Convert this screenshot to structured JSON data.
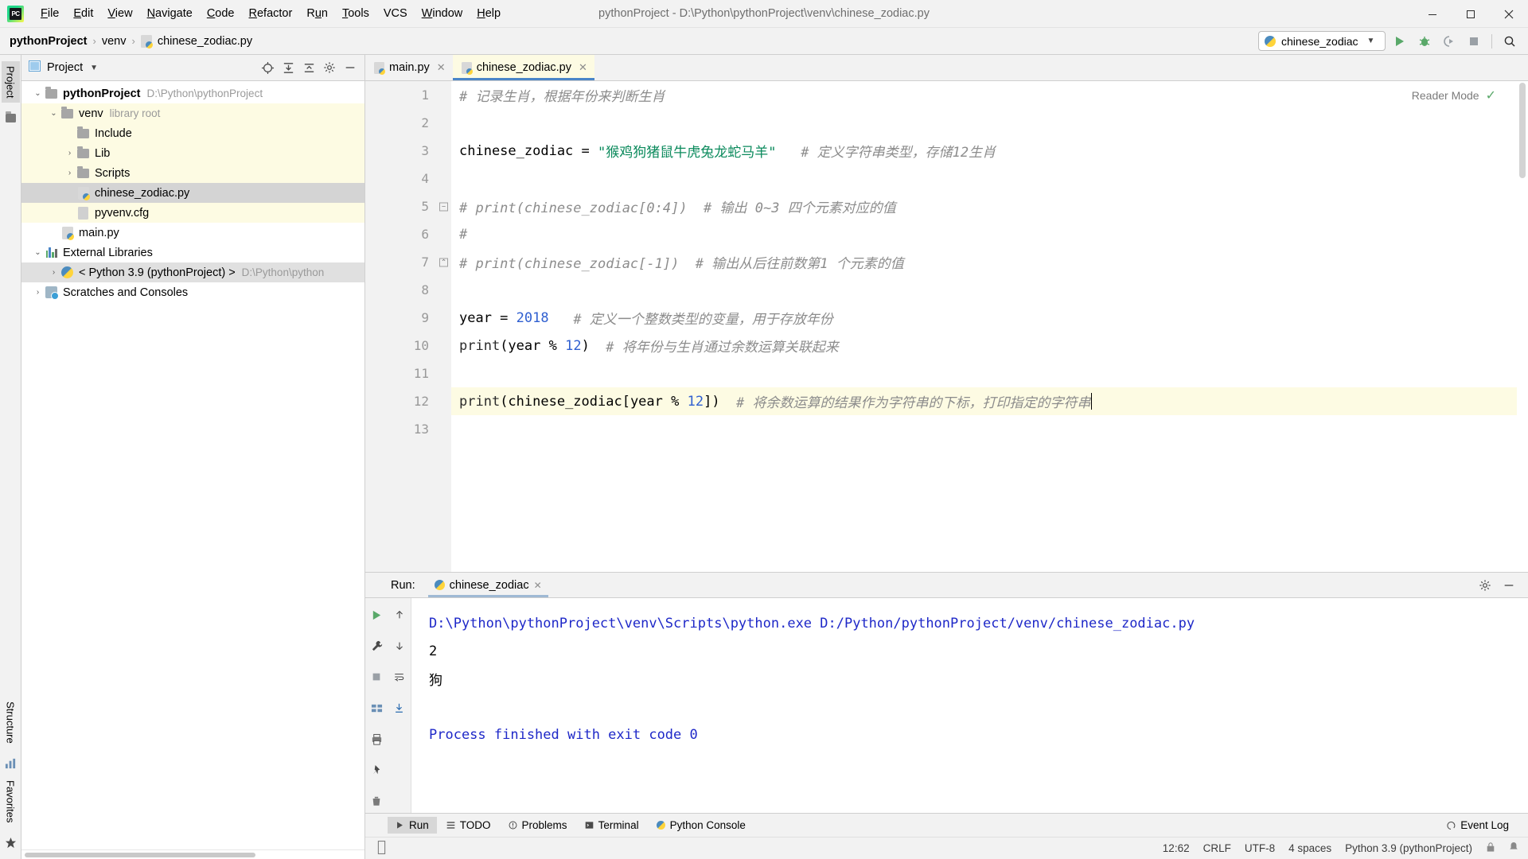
{
  "window": {
    "title": "pythonProject - D:\\Python\\pythonProject\\venv\\chinese_zodiac.py",
    "minimize": "—",
    "maximize": "❐",
    "close": "✕",
    "logo_text": "PC"
  },
  "menu": [
    {
      "pre": "",
      "key": "F",
      "post": "ile"
    },
    {
      "pre": "",
      "key": "E",
      "post": "dit"
    },
    {
      "pre": "",
      "key": "V",
      "post": "iew"
    },
    {
      "pre": "",
      "key": "N",
      "post": "avigate"
    },
    {
      "pre": "",
      "key": "C",
      "post": "ode"
    },
    {
      "pre": "",
      "key": "R",
      "post": "efactor"
    },
    {
      "pre": "R",
      "key": "u",
      "post": "n"
    },
    {
      "pre": "",
      "key": "T",
      "post": "ools"
    },
    {
      "pre": "VCS",
      "key": "",
      "post": ""
    },
    {
      "pre": "",
      "key": "W",
      "post": "indow"
    },
    {
      "pre": "",
      "key": "H",
      "post": "elp"
    }
  ],
  "breadcrumb": {
    "project": "pythonProject",
    "sep1": "›",
    "venv": "venv",
    "sep2": "›",
    "file": "chinese_zodiac.py"
  },
  "toolbar": {
    "run_config": "chinese_zodiac",
    "dropdown_caret": "▼",
    "run_label": "Run",
    "debug_label": "Debug",
    "coverage_label": "Run with Coverage",
    "stop_label": "Stop",
    "search_label": "Search Everywhere"
  },
  "project_panel": {
    "title": "Project",
    "title_caret": "▼",
    "rail_label": "Project",
    "tree": [
      {
        "indent": 0,
        "arrow": "⌄",
        "icon": "folder",
        "label": "pythonProject",
        "sub": "D:\\Python\\pythonProject",
        "bold": true,
        "state": "normal"
      },
      {
        "indent": 1,
        "arrow": "⌄",
        "icon": "folder",
        "label": "venv",
        "sub": "library root",
        "bold": false,
        "state": "hl"
      },
      {
        "indent": 2,
        "arrow": "",
        "icon": "folder",
        "label": "Include",
        "sub": "",
        "bold": false,
        "state": "hl"
      },
      {
        "indent": 2,
        "arrow": "›",
        "icon": "folder",
        "label": "Lib",
        "sub": "",
        "bold": false,
        "state": "hl"
      },
      {
        "indent": 2,
        "arrow": "›",
        "icon": "folder",
        "label": "Scripts",
        "sub": "",
        "bold": false,
        "state": "hl"
      },
      {
        "indent": 2,
        "arrow": "",
        "icon": "python-file",
        "label": "chinese_zodiac.py",
        "sub": "",
        "bold": false,
        "state": "sel"
      },
      {
        "indent": 2,
        "arrow": "",
        "icon": "cfg-file",
        "label": "pyvenv.cfg",
        "sub": "",
        "bold": false,
        "state": "hl"
      },
      {
        "indent": 1,
        "arrow": "",
        "icon": "python-file",
        "label": "main.py",
        "sub": "",
        "bold": false,
        "state": "normal"
      },
      {
        "indent": 0,
        "arrow": "⌄",
        "icon": "libraries",
        "label": "External Libraries",
        "sub": "",
        "bold": false,
        "state": "normal"
      },
      {
        "indent": 1,
        "arrow": "›",
        "icon": "python-snake",
        "label": "< Python 3.9 (pythonProject) >",
        "sub": "D:\\Python\\python",
        "bold": false,
        "state": "sel-soft"
      },
      {
        "indent": 0,
        "arrow": "›",
        "icon": "scratches",
        "label": "Scratches and Consoles",
        "sub": "",
        "bold": false,
        "state": "normal"
      }
    ]
  },
  "editor": {
    "tabs": [
      {
        "label": "main.py",
        "active": false,
        "close": "✕"
      },
      {
        "label": "chinese_zodiac.py",
        "active": true,
        "close": "✕"
      }
    ],
    "reader_mode": "Reader Mode",
    "reader_check": "✓",
    "line_numbers": [
      "1",
      "2",
      "3",
      "4",
      "5",
      "6",
      "7",
      "8",
      "9",
      "10",
      "11",
      "12",
      "13"
    ],
    "lines": [
      {
        "n": 1,
        "fold": "",
        "caret": false,
        "tokens": [
          {
            "t": "cmt",
            "v": "# 记录生肖，根据年份来判断生肖"
          }
        ]
      },
      {
        "n": 2,
        "fold": "",
        "caret": false,
        "tokens": []
      },
      {
        "n": 3,
        "fold": "",
        "caret": false,
        "tokens": [
          {
            "t": "plain",
            "v": "chinese_zodiac = "
          },
          {
            "t": "str",
            "v": "\"猴鸡狗猪鼠牛虎兔龙蛇马羊\""
          },
          {
            "t": "cmt",
            "v": "   # 定义字符串类型，存储12生肖"
          }
        ]
      },
      {
        "n": 4,
        "fold": "",
        "caret": false,
        "tokens": []
      },
      {
        "n": 5,
        "fold": "−",
        "caret": false,
        "tokens": [
          {
            "t": "cmt",
            "v": "# print(chinese_zodiac[0:4])  # 输出 0~3 四个元素对应的值"
          }
        ]
      },
      {
        "n": 6,
        "fold": "",
        "caret": false,
        "tokens": [
          {
            "t": "cmt",
            "v": "#"
          }
        ]
      },
      {
        "n": 7,
        "fold": "⌃",
        "caret": false,
        "tokens": [
          {
            "t": "cmt",
            "v": "# print(chinese_zodiac[-1])  # 输出从后往前数第1 个元素的值"
          }
        ]
      },
      {
        "n": 8,
        "fold": "",
        "caret": false,
        "tokens": []
      },
      {
        "n": 9,
        "fold": "",
        "caret": false,
        "tokens": [
          {
            "t": "plain",
            "v": "year = "
          },
          {
            "t": "num",
            "v": "2018"
          },
          {
            "t": "cmt",
            "v": "   # 定义一个整数类型的变量，用于存放年份"
          }
        ]
      },
      {
        "n": 10,
        "fold": "",
        "caret": false,
        "tokens": [
          {
            "t": "fn",
            "v": "print"
          },
          {
            "t": "plain",
            "v": "(year % "
          },
          {
            "t": "num",
            "v": "12"
          },
          {
            "t": "plain",
            "v": ")"
          },
          {
            "t": "cmt",
            "v": "  # 将年份与生肖通过余数运算关联起来"
          }
        ]
      },
      {
        "n": 11,
        "fold": "",
        "caret": false,
        "tokens": []
      },
      {
        "n": 12,
        "fold": "",
        "caret": true,
        "tokens": [
          {
            "t": "fn",
            "v": "print"
          },
          {
            "t": "plain",
            "v": "(chinese_zodiac[year % "
          },
          {
            "t": "num",
            "v": "12"
          },
          {
            "t": "plain",
            "v": "])"
          },
          {
            "t": "cmt",
            "v": "  # 将余数运算的结果作为字符串的下标，打印指定的字符串"
          }
        ]
      },
      {
        "n": 13,
        "fold": "",
        "caret": false,
        "tokens": []
      }
    ]
  },
  "run_window": {
    "label": "Run:",
    "tab_label": "chinese_zodiac",
    "tab_close": "✕",
    "settings_label": "Settings",
    "hide_label": "Hide",
    "console": [
      {
        "cls": "cmd",
        "text": "D:\\Python\\pythonProject\\venv\\Scripts\\python.exe D:/Python/pythonProject/venv/chinese_zodiac.py"
      },
      {
        "cls": "out",
        "text": "2"
      },
      {
        "cls": "out",
        "text": "狗"
      },
      {
        "cls": "out",
        "text": ""
      },
      {
        "cls": "fin",
        "text": "Process finished with exit code 0"
      }
    ]
  },
  "toolstrip": {
    "items": [
      {
        "label": "Run",
        "icon": "run-triangle-icon",
        "active": true
      },
      {
        "label": "TODO",
        "icon": "todo-icon",
        "active": false
      },
      {
        "label": "Problems",
        "icon": "problems-icon",
        "active": false
      },
      {
        "label": "Terminal",
        "icon": "terminal-icon",
        "active": false
      },
      {
        "label": "Python Console",
        "icon": "python-console-icon",
        "active": false
      }
    ],
    "event_log": "Event Log"
  },
  "statusbar": {
    "position": "12:62",
    "line_sep": "CRLF",
    "encoding": "UTF-8",
    "indent": "4 spaces",
    "interpreter": "Python 3.9 (pythonProject)"
  },
  "left_rail": {
    "structure": "Structure",
    "favorites": "Favorites"
  },
  "colors": {
    "accent_green": "#59a869",
    "string_green": "#0b8a5c",
    "number_blue": "#2f5fd0",
    "comment_gray": "#8c8c8c",
    "console_blue": "#1e28c8",
    "highlight_yellow": "#fdfbe3",
    "selection_gray": "#d4d4d4"
  }
}
